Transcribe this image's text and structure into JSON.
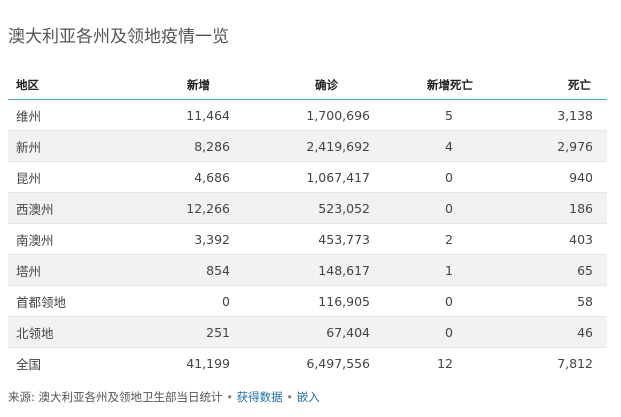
{
  "title": "澳大利亚各州及领地疫情一览",
  "table": {
    "headers": {
      "region": "地区",
      "new_cases": "新增",
      "confirmed": "确诊",
      "new_deaths": "新增死亡",
      "deaths": "死亡"
    },
    "rows": [
      {
        "region": "维州",
        "new_cases": "11,464",
        "confirmed": "1,700,696",
        "new_deaths": "5",
        "deaths": "3,138"
      },
      {
        "region": "新州",
        "new_cases": "8,286",
        "confirmed": "2,419,692",
        "new_deaths": "4",
        "deaths": "2,976"
      },
      {
        "region": "昆州",
        "new_cases": "4,686",
        "confirmed": "1,067,417",
        "new_deaths": "0",
        "deaths": "940"
      },
      {
        "region": "西澳州",
        "new_cases": "12,266",
        "confirmed": "523,052",
        "new_deaths": "0",
        "deaths": "186"
      },
      {
        "region": "南澳州",
        "new_cases": "3,392",
        "confirmed": "453,773",
        "new_deaths": "2",
        "deaths": "403"
      },
      {
        "region": "塔州",
        "new_cases": "854",
        "confirmed": "148,617",
        "new_deaths": "1",
        "deaths": "65"
      },
      {
        "region": "首都领地",
        "new_cases": "0",
        "confirmed": "116,905",
        "new_deaths": "0",
        "deaths": "58"
      },
      {
        "region": "北领地",
        "new_cases": "251",
        "confirmed": "67,404",
        "new_deaths": "0",
        "deaths": "46"
      }
    ],
    "total": {
      "region": "全国",
      "new_cases": "41,199",
      "confirmed": "6,497,556",
      "new_deaths": "12",
      "deaths": "7,812"
    }
  },
  "footer": {
    "source_text": "来源: 澳大利亚各州及领地卫生部当日统计",
    "separator": "•",
    "get_data_label": "获得数据",
    "embed_label": "嵌入"
  },
  "colors": {
    "accent_line": "#4ea8c7",
    "link": "#1d6fa8",
    "stripe": "#f2f2f2"
  }
}
